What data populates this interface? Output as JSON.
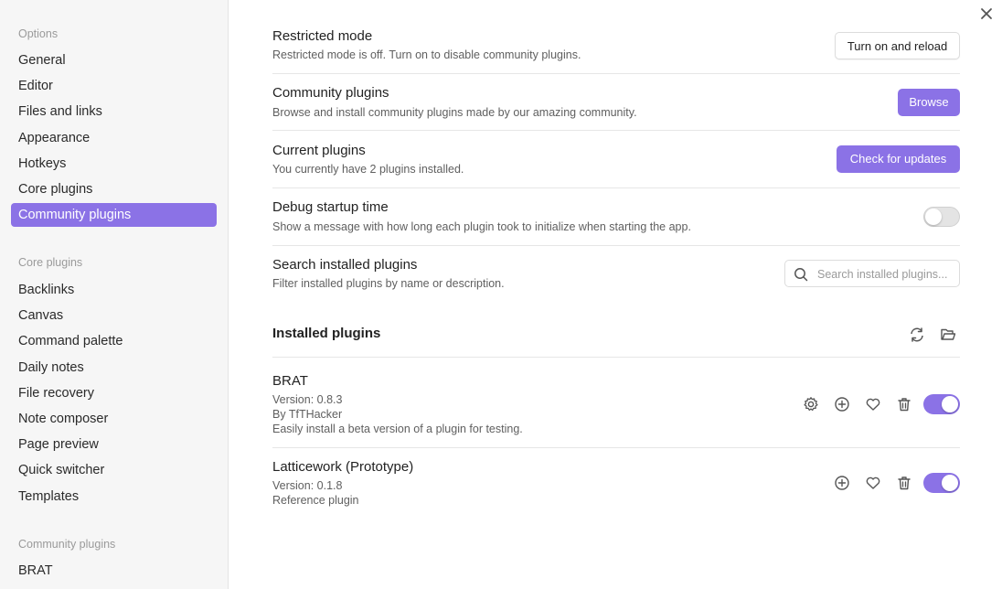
{
  "sidebar": {
    "options_heading": "Options",
    "options_items": [
      {
        "label": "General"
      },
      {
        "label": "Editor"
      },
      {
        "label": "Files and links"
      },
      {
        "label": "Appearance"
      },
      {
        "label": "Hotkeys"
      },
      {
        "label": "Core plugins"
      },
      {
        "label": "Community plugins",
        "active": true
      }
    ],
    "core_heading": "Core plugins",
    "core_items": [
      {
        "label": "Backlinks"
      },
      {
        "label": "Canvas"
      },
      {
        "label": "Command palette"
      },
      {
        "label": "Daily notes"
      },
      {
        "label": "File recovery"
      },
      {
        "label": "Note composer"
      },
      {
        "label": "Page preview"
      },
      {
        "label": "Quick switcher"
      },
      {
        "label": "Templates"
      }
    ],
    "community_heading": "Community plugins",
    "community_items": [
      {
        "label": "BRAT"
      }
    ]
  },
  "close_icon": "close-icon",
  "settings": {
    "restricted": {
      "title": "Restricted mode",
      "desc": "Restricted mode is off. Turn on to disable community plugins.",
      "button": "Turn on and reload"
    },
    "community": {
      "title": "Community plugins",
      "desc": "Browse and install community plugins made by our amazing community.",
      "button": "Browse"
    },
    "current": {
      "title": "Current plugins",
      "desc": "You currently have 2 plugins installed.",
      "button": "Check for updates"
    },
    "debug": {
      "title": "Debug startup time",
      "desc": "Show a message with how long each plugin took to initialize when starting the app.",
      "enabled": false
    },
    "search": {
      "title": "Search installed plugins",
      "desc": "Filter installed plugins by name or description.",
      "placeholder": "Search installed plugins..."
    }
  },
  "installed": {
    "heading": "Installed plugins",
    "icons": [
      "reload-icon",
      "folder-icon"
    ],
    "plugins": [
      {
        "name": "BRAT",
        "version": "Version: 0.8.3",
        "author": "By TfTHacker",
        "desc": "Easily install a beta version of a plugin for testing.",
        "enabled": true,
        "icons": [
          "gear-icon",
          "plus-circle-icon",
          "heart-icon",
          "trash-icon"
        ]
      },
      {
        "name": "Latticework (Prototype)",
        "version": "Version: 0.1.8",
        "desc": "Reference plugin",
        "enabled": true,
        "icons": [
          "plus-circle-icon",
          "heart-icon",
          "trash-icon"
        ]
      }
    ]
  },
  "colors": {
    "accent": "#8b72e6",
    "sidebar_bg": "#f6f6f6"
  }
}
